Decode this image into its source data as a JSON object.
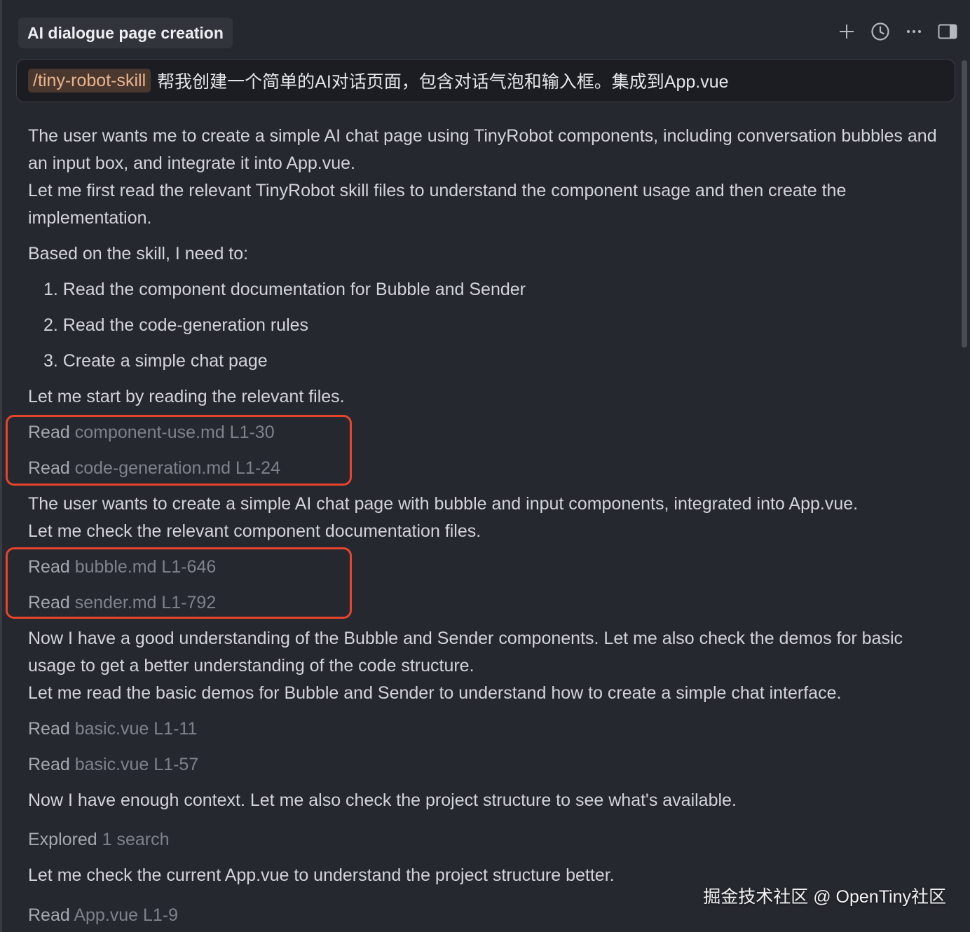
{
  "header": {
    "title": "AI dialogue page creation",
    "toolbar": [
      {
        "name": "new-chat",
        "icon": "plus-icon"
      },
      {
        "name": "history",
        "icon": "clock-icon"
      },
      {
        "name": "more",
        "icon": "ellipsis-icon"
      },
      {
        "name": "toggle-panel",
        "icon": "panel-right-icon"
      }
    ]
  },
  "prompt": {
    "skill_tag": "/tiny-robot-skill",
    "text": "帮我创建一个简单的AI对话页面，包含对话气泡和输入框。集成到App.vue"
  },
  "messages": {
    "intro_1": "The user wants me to create a simple AI chat page using TinyRobot components, including conversation bubbles and an input box, and integrate it into App.vue.",
    "intro_2": "Let me first read the relevant TinyRobot skill files to understand the component usage and then create the implementation.",
    "based_on": "Based on the skill, I need to:",
    "steps": [
      "1. Read the component documentation for Bubble and Sender",
      "2. Read the code-generation rules",
      "3. Create a simple chat page"
    ],
    "start": "Let me start by reading the relevant files.",
    "mid_1": "The user wants to create a simple AI chat page with bubble and input components, integrated into App.vue.",
    "mid_2": "Let me check the relevant component documentation files.",
    "now_1": "Now I have a good understanding of the Bubble and Sender components. Let me also check the demos for basic usage to get a better understanding of the code structure.",
    "now_2": "Let me read the basic demos for Bubble and Sender to understand how to create a simple chat interface.",
    "context": "Now I have enough context. Let me also check the project structure to see what's available.",
    "check_app": "Let me check the current App.vue to understand the project structure better."
  },
  "tool_calls": [
    {
      "verb": "Read",
      "target": "component-use.md L1-30"
    },
    {
      "verb": "Read",
      "target": "code-generation.md L1-24"
    },
    {
      "verb": "Read",
      "target": "bubble.md L1-646"
    },
    {
      "verb": "Read",
      "target": "sender.md L1-792"
    },
    {
      "verb": "Read",
      "target": "basic.vue L1-11"
    },
    {
      "verb": "Read",
      "target": "basic.vue L1-57"
    },
    {
      "verb": "Explored",
      "target": "1 search"
    },
    {
      "verb": "Read",
      "target": "App.vue L1-9"
    }
  ],
  "watermark": "掘金技术社区 @ OpenTiny社区",
  "colors": {
    "background": "#262830",
    "prompt_background": "#1c1d22",
    "skill_tag_text": "#e9b48e",
    "highlight_border": "#e8442c"
  }
}
